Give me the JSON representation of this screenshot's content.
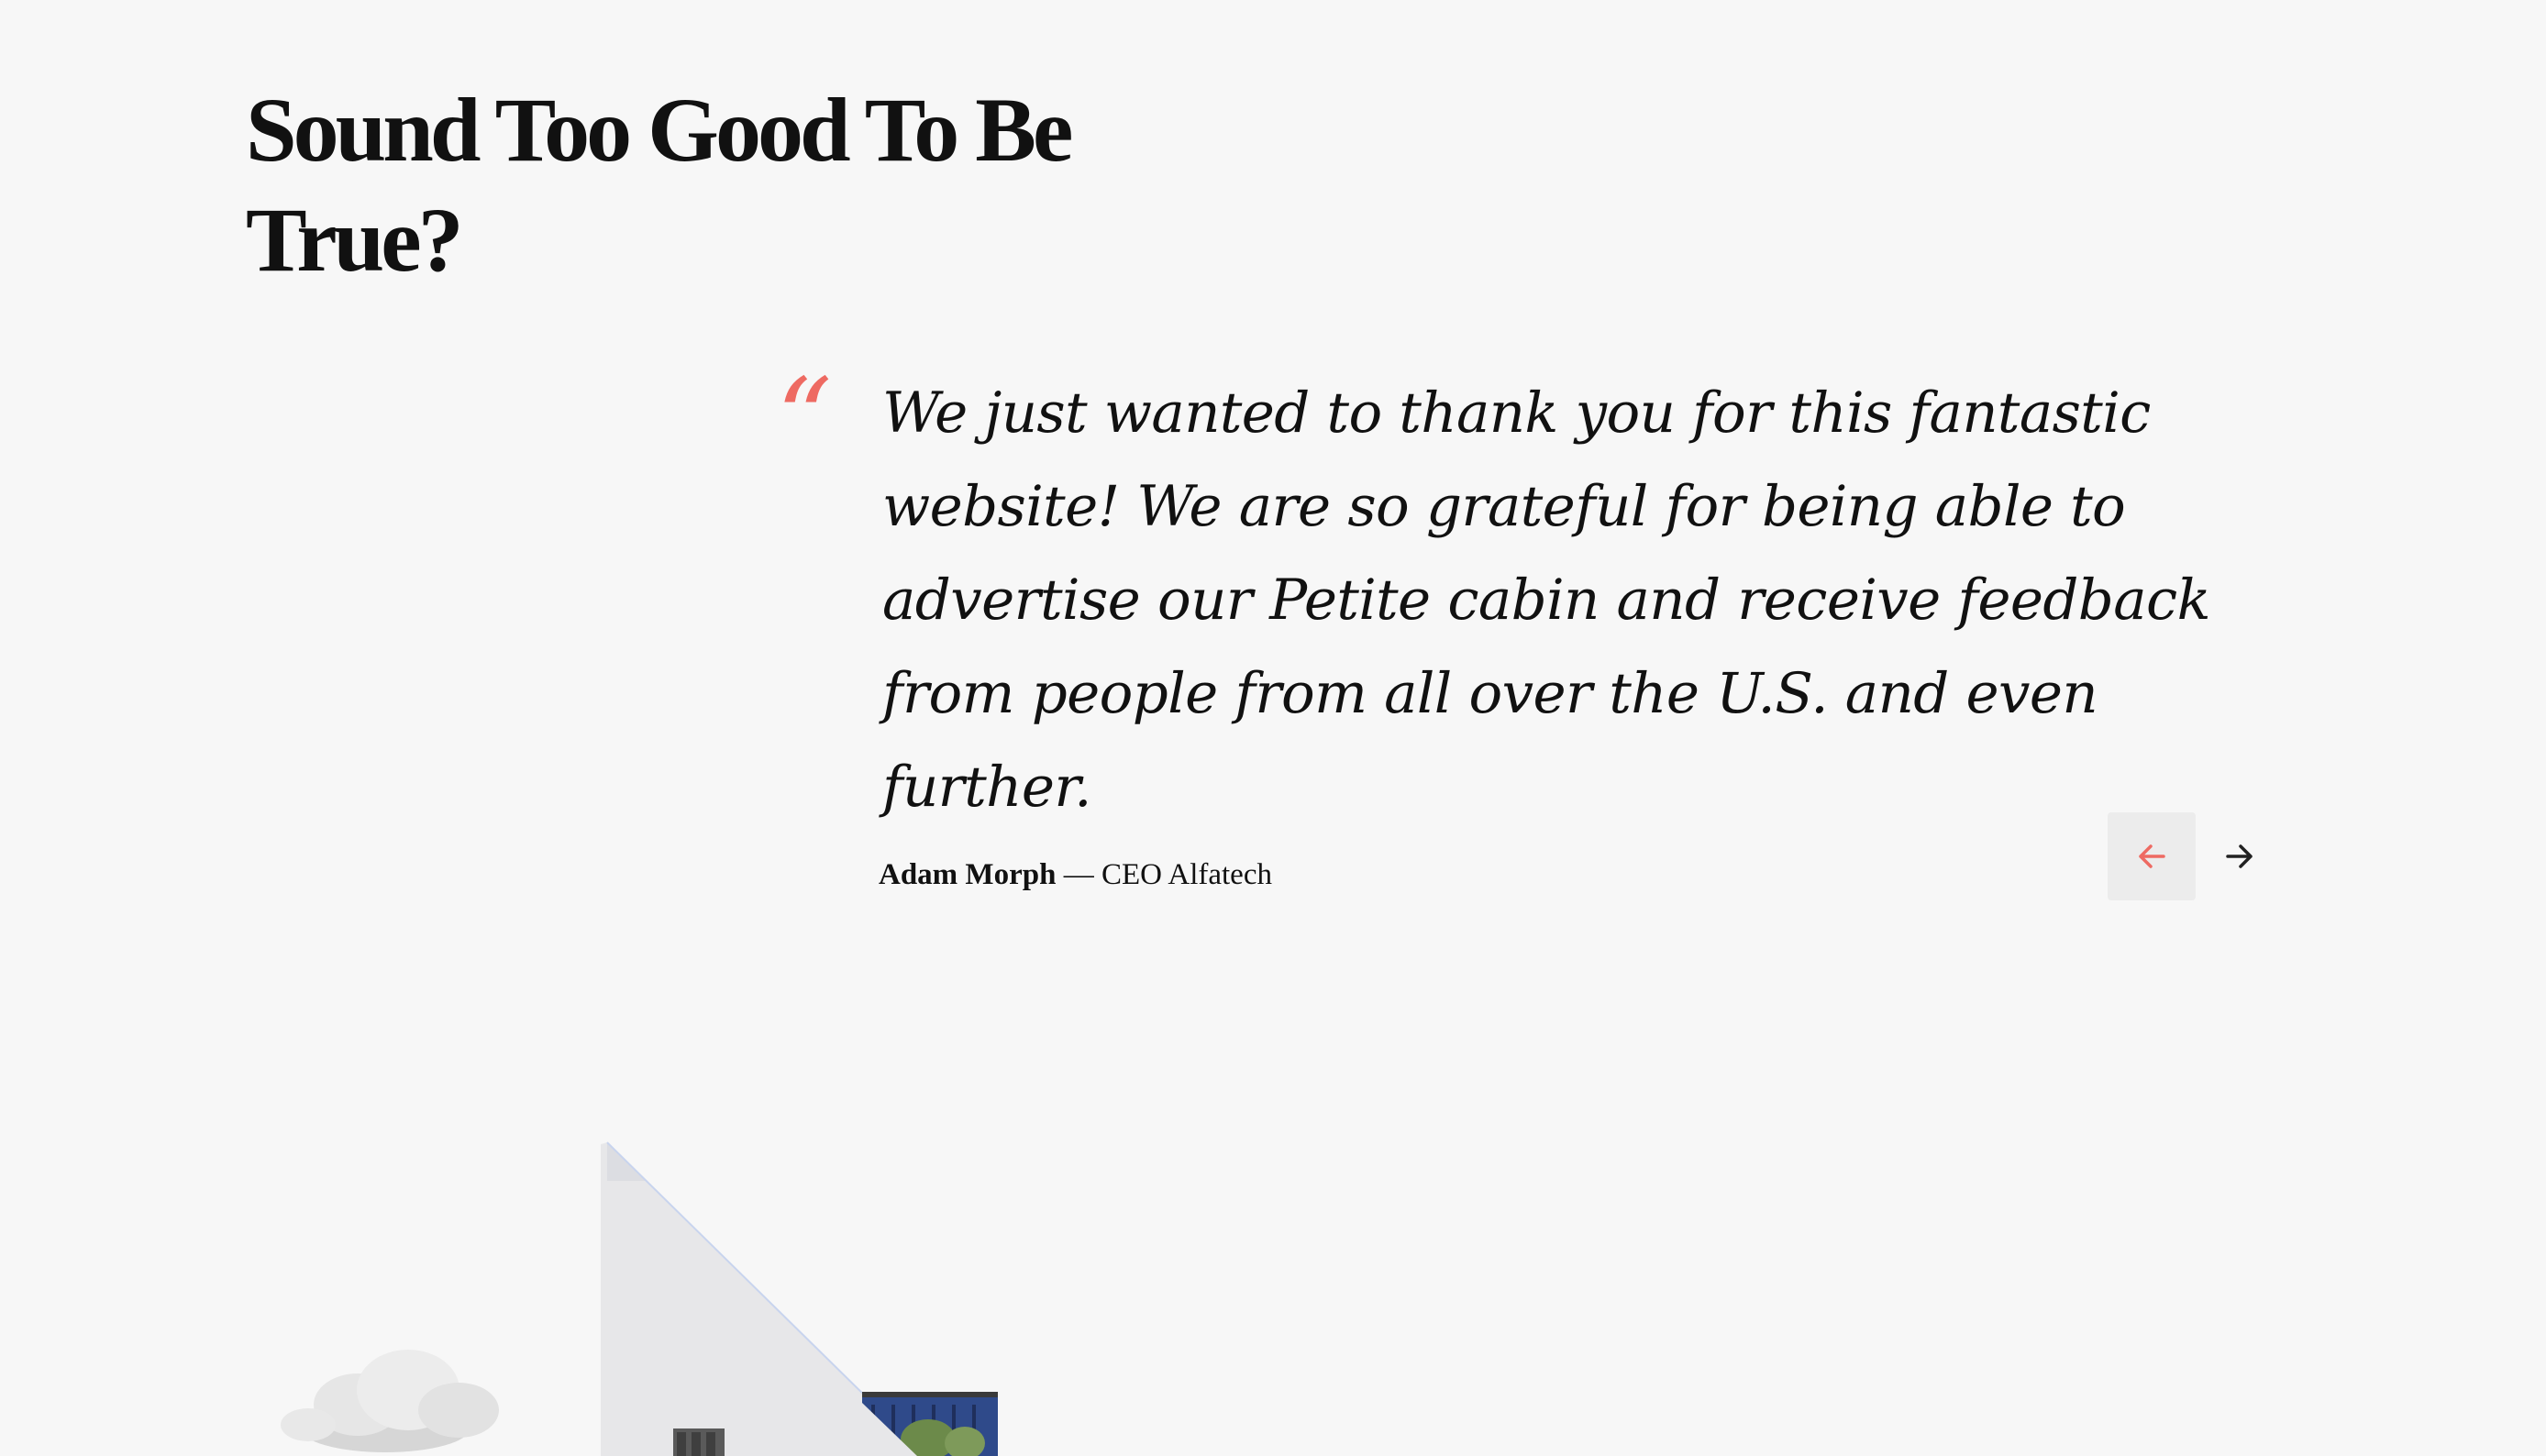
{
  "section": {
    "heading": "Sound Too Good To Be True?"
  },
  "testimonial": {
    "quote_mark": "“",
    "text": "We just wanted to thank you for this fantastic website! We are so grateful for being able to advertise our Petite cabin and receive feedback from people from all over the U.S. and even further.",
    "author_name": "Adam Morph",
    "author_separator": " — ",
    "author_role": "CEO Alfatech"
  },
  "navigation": {
    "prev_icon": "arrow-left-icon",
    "next_icon": "arrow-right-icon"
  },
  "illustration": {
    "subject": "house-icon"
  },
  "colors": {
    "background": "#f7f7f7",
    "accent": "#ee6a62",
    "text": "#111111",
    "button_background": "#ececec"
  }
}
